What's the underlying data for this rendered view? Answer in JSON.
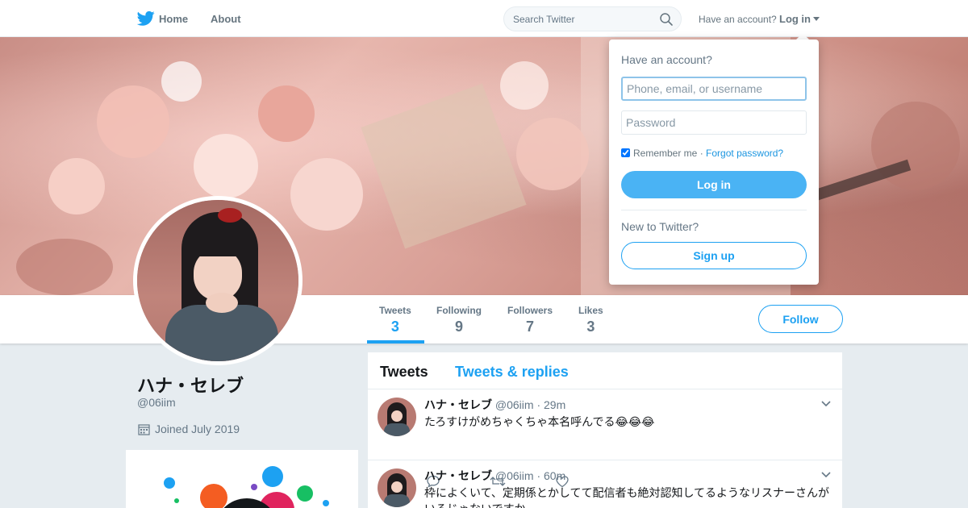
{
  "nav": {
    "home_label": "Home",
    "about_label": "About",
    "search_placeholder": "Search Twitter",
    "have_account": "Have an account?",
    "login_label": "Log in"
  },
  "profile": {
    "name": "ハナ・セレブ",
    "handle": "@06iim",
    "joined": "Joined July 2019",
    "stats": [
      {
        "label": "Tweets",
        "value": "3"
      },
      {
        "label": "Following",
        "value": "9"
      },
      {
        "label": "Followers",
        "value": "7"
      },
      {
        "label": "Likes",
        "value": "3"
      }
    ],
    "follow_label": "Follow"
  },
  "timeline": {
    "tabs": [
      {
        "label": "Tweets"
      },
      {
        "label": "Tweets & replies"
      }
    ],
    "tweets": [
      {
        "name": "ハナ・セレブ",
        "handle": "@06iim",
        "time": "· 29m",
        "text": "たろすけがめちゃくちゃ本名呼んでる😂😂😂"
      },
      {
        "name": "ハナ・セレブ",
        "handle": "@06iim",
        "time": "· 60m",
        "text": "枠によくいて、定期係とかしてて配信者も絶対認知してるようなリスナーさんがいるじゃないですか"
      }
    ]
  },
  "login_dropdown": {
    "title": "Have an account?",
    "username_placeholder": "Phone, email, or username",
    "password_placeholder": "Password",
    "remember_label": "Remember me",
    "separator": "·",
    "forgot_label": "Forgot password?",
    "login_button": "Log in",
    "new_label": "New to Twitter?",
    "signup_button": "Sign up"
  },
  "colors": {
    "accent": "#1da1f2",
    "background": "#e6ecf0",
    "muted_text": "#657786"
  }
}
